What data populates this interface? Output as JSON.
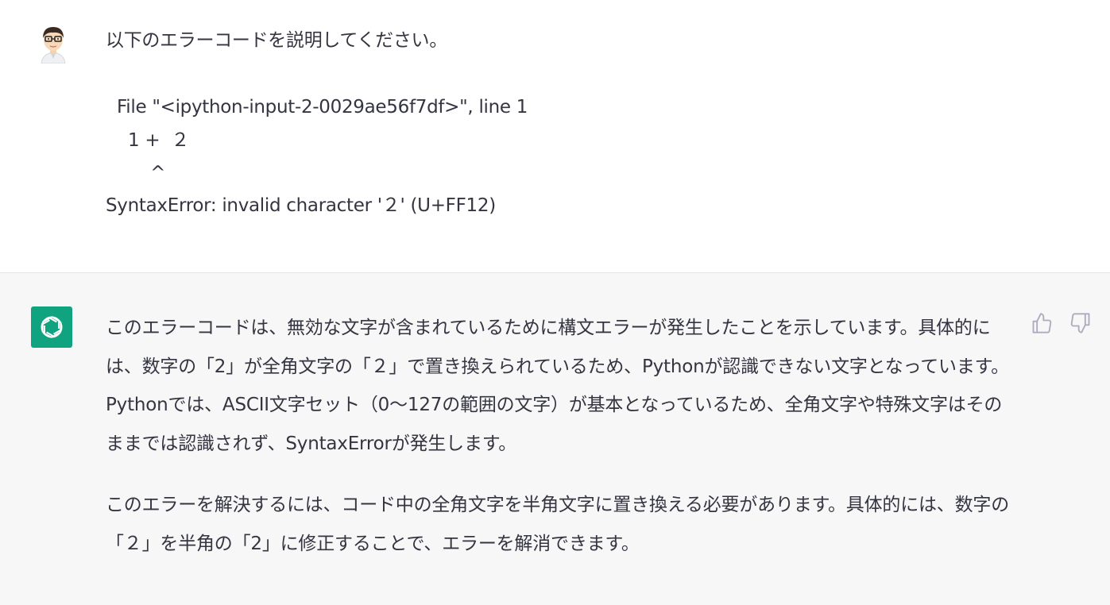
{
  "user_message": {
    "lines": [
      "以下のエラーコードを説明してください。",
      "",
      "  File \"<ipython-input-2-0029ae56f7df>\", line 1",
      "    1 +  ２",
      "        ^",
      "SyntaxError: invalid character '２' (U+FF12)"
    ]
  },
  "assistant_message": {
    "paragraphs": [
      "このエラーコードは、無効な文字が含まれているために構文エラーが発生したことを示しています。具体的には、数字の「2」が全角文字の「２」で置き換えられているため、Pythonが認識できない文字となっています。Pythonでは、ASCII文字セット（0〜127の範囲の文字）が基本となっているため、全角文字や特殊文字はそのままでは認識されず、SyntaxErrorが発生します。",
      "このエラーを解決するには、コード中の全角文字を半角文字に置き換える必要があります。具体的には、数字の「２」を半角の「2」に修正することで、エラーを解消できます。"
    ]
  },
  "icons": {
    "user_avatar": "user-avatar-icon",
    "assistant_avatar": "openai-logo-icon",
    "feedback_up": "thumbs-up-icon",
    "feedback_down": "thumbs-down-icon"
  },
  "colors": {
    "assistant_background": "#f7f7f8",
    "avatar_green": "#10a37f",
    "text": "#343541",
    "icon_gray": "#acacbe"
  }
}
